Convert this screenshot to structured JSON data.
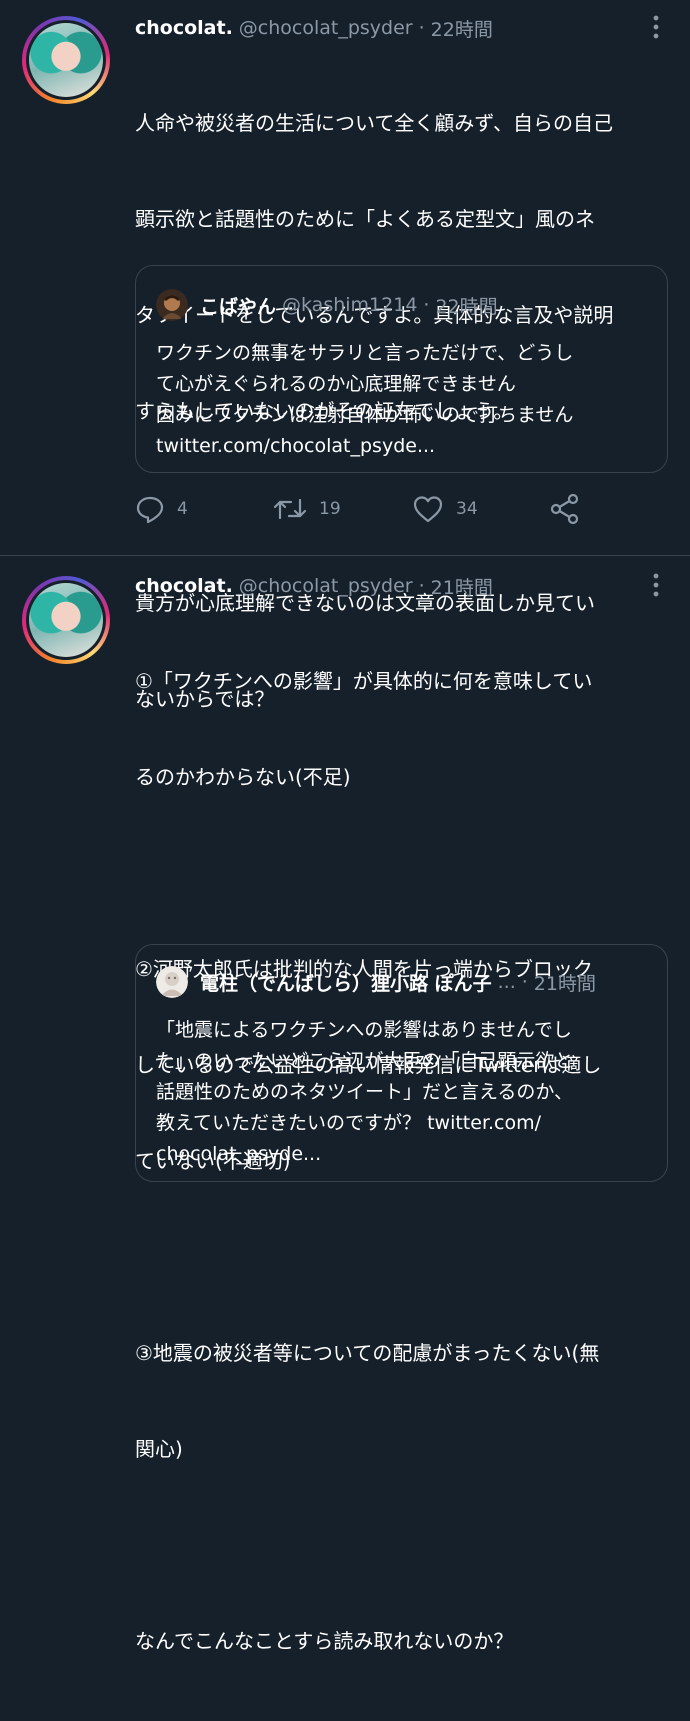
{
  "tweets": [
    {
      "display_name": "chocolat.",
      "handle": "@chocolat_psyder",
      "dot": "·",
      "time": "22時間",
      "lines": [
        "人命や被災者の生活について全く顧みず、自らの自己",
        "顕示欲と話題性のために「よくある定型文」風のネ",
        "タツイートをしているんですよ。具体的な言及や説明",
        "すらもしていないのがその証左でしょう。",
        "",
        "貴方が心底理解できないのは文章の表面しか見てい",
        "ないからでは？"
      ],
      "quote": {
        "display_name": "こばやん",
        "handle": "@kashim1214",
        "dot": "·",
        "time": "22時間",
        "lines": [
          "ワクチンの無事をサラリと言っただけで、どうし",
          "て心がえぐられるのか心底理解できません",
          "因みにワクチンは注射自体が怖いので打ちません",
          "twitter.com/chocolat_psyde..."
        ]
      },
      "actions": {
        "reply_count": "4",
        "retweet_count": "19",
        "like_count": "34"
      }
    },
    {
      "display_name": "chocolat.",
      "handle": "@chocolat_psyder",
      "dot": "·",
      "time": "21時間",
      "lines": [
        "①「ワクチンへの影響」が具体的に何を意味してい",
        "るのかわからない(不足)",
        "",
        "②河野太郎氏は批判的な人間を片っ端からブロック",
        "しているので公益性の高い情報発信にTwitterは適し",
        "ていない(不適切)",
        "",
        "③地震の被災者等についての配慮がまったくない(無",
        "関心)",
        "",
        "なんでこんなことすら読み取れないのか？"
      ],
      "quote": {
        "display_name": "電柱（でんばしら）狸小路 ぽん子",
        "handle": "...",
        "dot": "·",
        "time": "21時間",
        "lines": [
          "「地震によるワクチンへの影響はありませんでし",
          "た」のいったいどこら辺が大臣の「自己顕示欲と",
          "話題性のためのネタツイート」だと言えるのか、",
          "教えていただきたいのですが？ twitter.com/",
          "chocolat_psyde..."
        ]
      }
    }
  ],
  "colors": {
    "background": "#15202b",
    "text_primary": "#ffffff",
    "text_secondary": "#8b98a5",
    "border": "#38444d"
  },
  "icons": [
    "more-vertical-icon",
    "reply-icon",
    "retweet-icon",
    "like-icon",
    "share-icon"
  ]
}
